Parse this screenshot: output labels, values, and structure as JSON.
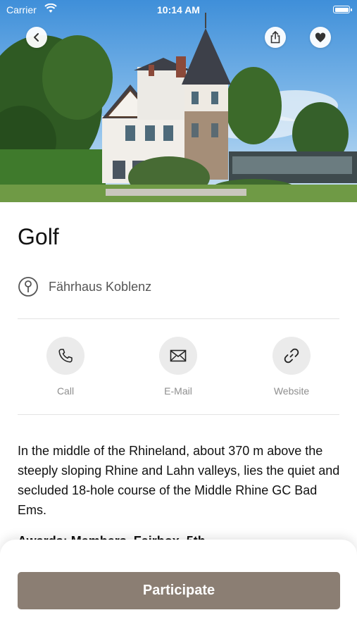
{
  "status_bar": {
    "carrier": "Carrier",
    "time": "10:14 AM"
  },
  "nav": {
    "back_icon": "chevron-left-icon",
    "share_icon": "share-icon",
    "favorite_icon": "heart-icon"
  },
  "event": {
    "title": "Golf",
    "location": "Fährhaus Koblenz",
    "description": "In the middle of the Rhineland, about 370 m above the steeply sloping Rhine and Lahn valleys, lies the quiet and secluded 18-hole course of the Middle Rhine GC Bad Ems.",
    "next_heading": "Awards: Members, Fairbox, 5th..."
  },
  "actions": [
    {
      "label": "Call",
      "icon": "phone-icon"
    },
    {
      "label": "E-Mail",
      "icon": "mail-icon"
    },
    {
      "label": "Website",
      "icon": "link-icon"
    }
  ],
  "cta": {
    "participate_label": "Participate"
  },
  "colors": {
    "accent": "#8b7e73",
    "icon_bg": "#ebebeb",
    "label_gray": "#8e8e8e"
  }
}
